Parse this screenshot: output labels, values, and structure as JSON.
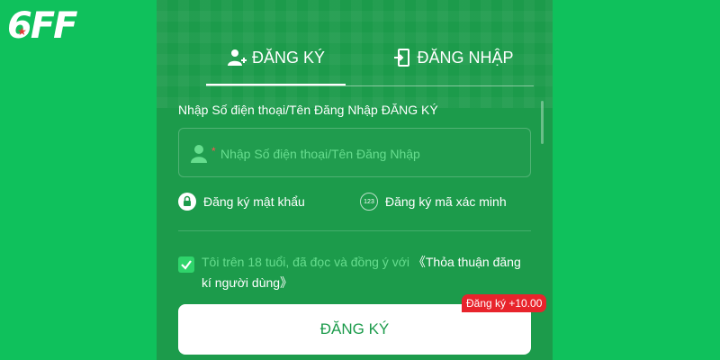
{
  "brand": {
    "logo_text": "6FF"
  },
  "tabs": [
    {
      "label": "ĐĂNG KÝ",
      "active": true
    },
    {
      "label": "ĐĂNG NHẬP",
      "active": false
    }
  ],
  "form": {
    "field_title": "Nhập Số điện thoại/Tên Đăng Nhập ĐĂNG KÝ",
    "required_mark": "*",
    "username_placeholder": "Nhập Số điện thoại/Tên Đăng Nhập",
    "option_password": "Đăng ký mật khẩu",
    "option_code_badge": "123",
    "option_code": "Đăng ký mã xác minh",
    "agree_checked": true,
    "agree_text": "Tôi trên 18 tuổi, đã đọc và đồng ý với ",
    "agree_link": "《Thỏa thuận đăng kí người dùng》",
    "submit_label": "ĐĂNG KÝ",
    "bonus_badge": "Đăng ký +10.00"
  },
  "colors": {
    "background": "#0fc15c",
    "panel": "#1c9b4b",
    "accent_light": "#66dd8e",
    "badge_red": "#e8242c"
  }
}
